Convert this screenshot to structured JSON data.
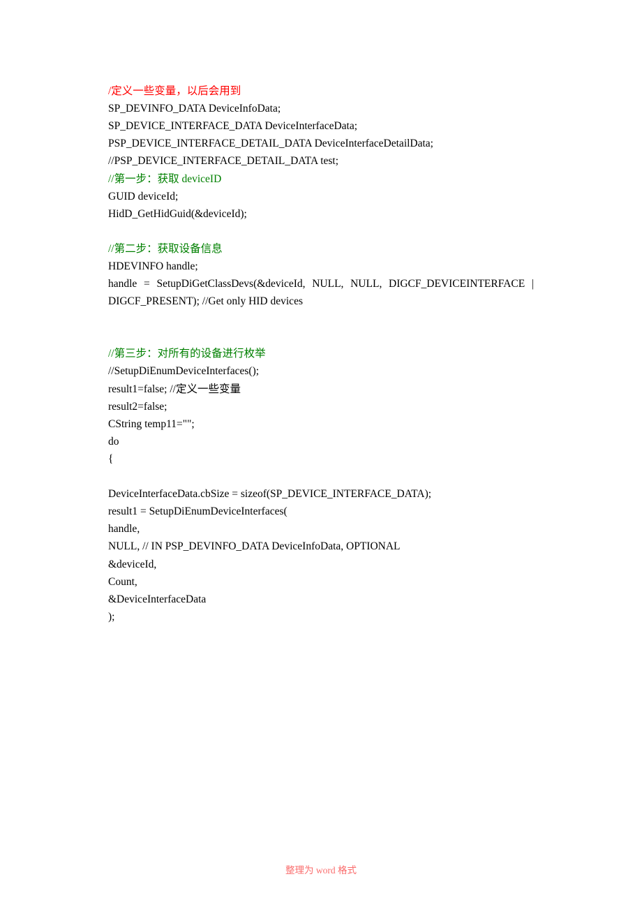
{
  "lines": [
    {
      "cls": "red",
      "text": "/定义一些变量，以后会用到"
    },
    {
      "cls": "black",
      "text": "SP_DEVINFO_DATA DeviceInfoData;"
    },
    {
      "cls": "black",
      "text": "SP_DEVICE_INTERFACE_DATA DeviceInterfaceData;"
    },
    {
      "cls": "black",
      "text": "PSP_DEVICE_INTERFACE_DETAIL_DATA DeviceInterfaceDetailData;"
    },
    {
      "cls": "black",
      "text": "//PSP_DEVICE_INTERFACE_DETAIL_DATA test;"
    },
    {
      "cls": "green",
      "text": "//第一步：获取 deviceID"
    },
    {
      "cls": "black",
      "text": "GUID deviceId;"
    },
    {
      "cls": "black",
      "text": "HidD_GetHidGuid(&deviceId);"
    },
    {
      "cls": "spacer",
      "text": ""
    },
    {
      "cls": "green",
      "text": "//第二步：获取设备信息"
    },
    {
      "cls": "black",
      "text": "HDEVINFO handle;"
    },
    {
      "cls": "black justify",
      "text": "handle = SetupDiGetClassDevs(&deviceId, NULL, NULL, DIGCF_DEVICEINTERFACE |"
    },
    {
      "cls": "black",
      "text": "DIGCF_PRESENT); //Get only HID devices"
    },
    {
      "cls": "spacer",
      "text": ""
    },
    {
      "cls": "spacer",
      "text": ""
    },
    {
      "cls": "green",
      "text": "//第三步：对所有的设备进行枚举"
    },
    {
      "cls": "black",
      "text": "//SetupDiEnumDeviceInterfaces();"
    },
    {
      "cls": "black",
      "text": "result1=false; //定义一些变量"
    },
    {
      "cls": "black",
      "text": "result2=false;"
    },
    {
      "cls": "black",
      "text": "CString temp11=\"\";"
    },
    {
      "cls": "black",
      "text": "do"
    },
    {
      "cls": "black",
      "text": "{"
    },
    {
      "cls": "spacer",
      "text": ""
    },
    {
      "cls": "black",
      "text": "DeviceInterfaceData.cbSize = sizeof(SP_DEVICE_INTERFACE_DATA);"
    },
    {
      "cls": "black",
      "text": "result1 = SetupDiEnumDeviceInterfaces("
    },
    {
      "cls": "black",
      "text": "handle,"
    },
    {
      "cls": "black",
      "text": "NULL, // IN PSP_DEVINFO_DATA DeviceInfoData, OPTIONAL"
    },
    {
      "cls": "black",
      "text": "&deviceId,"
    },
    {
      "cls": "black",
      "text": "Count,"
    },
    {
      "cls": "black",
      "text": "&DeviceInterfaceData"
    },
    {
      "cls": "black",
      "text": ");"
    }
  ],
  "footer": "整理为 word 格式"
}
